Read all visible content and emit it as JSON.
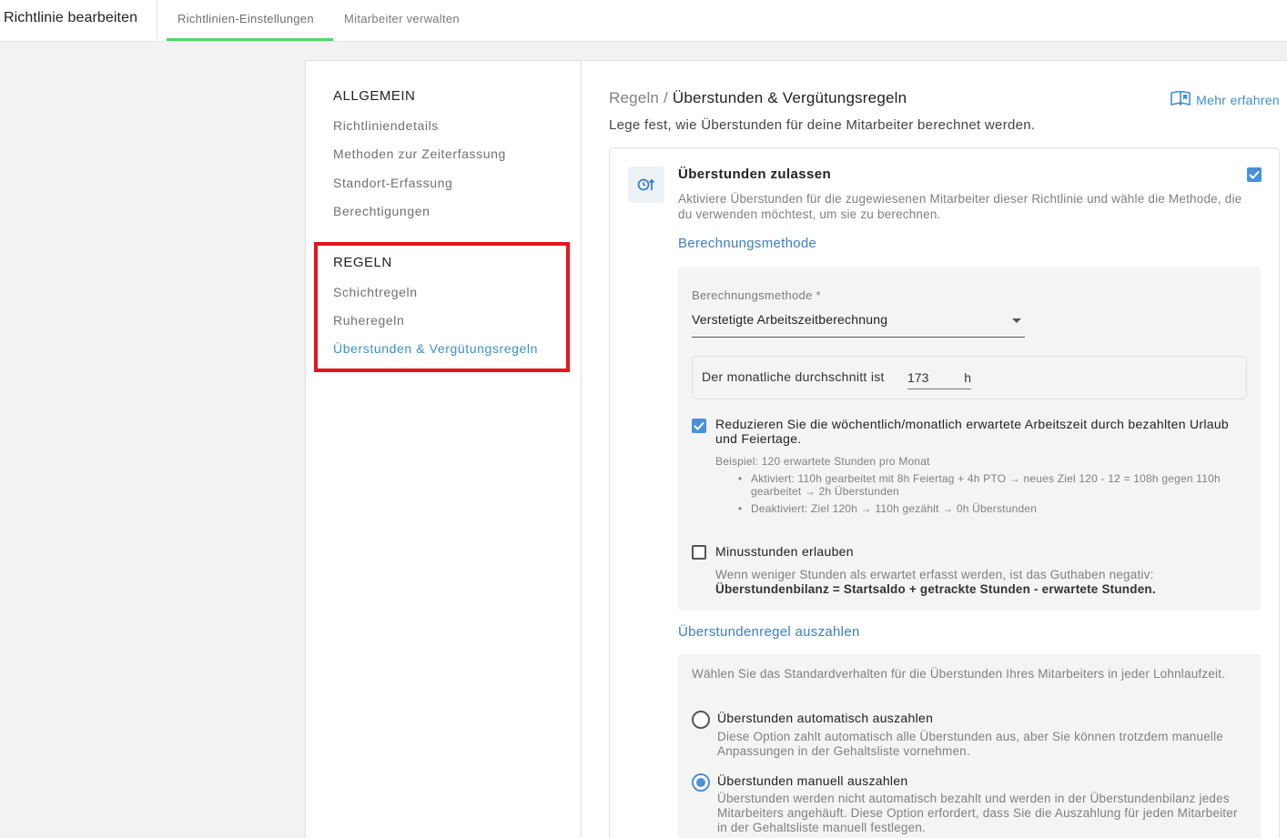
{
  "topbar": {
    "title": "Richtlinie bearbeiten",
    "tabs": [
      {
        "label": "Richtlinien-Einstellungen",
        "active": true
      },
      {
        "label": "Mitarbeiter verwalten",
        "active": false
      }
    ],
    "active_color": "#4cd964"
  },
  "sidebar": {
    "sections": [
      {
        "heading": "ALLGEMEIN",
        "items": [
          {
            "label": "Richtliniendetails"
          },
          {
            "label": "Methoden zur Zeiterfassung"
          },
          {
            "label": "Standort-Erfassung"
          },
          {
            "label": "Berechtigungen"
          }
        ]
      },
      {
        "heading": "REGELN",
        "items": [
          {
            "label": "Schichtregeln"
          },
          {
            "label": "Ruheregeln"
          },
          {
            "label": "Überstunden & Vergütungsregeln",
            "active": true
          }
        ]
      }
    ],
    "highlight_color": "#e8141b"
  },
  "main": {
    "breadcrumb_parent": "Regeln /",
    "breadcrumb_current": "Überstunden & Vergütungsregeln",
    "learn_more": "Mehr erfahren",
    "learn_more_icon": "book-icon",
    "subtitle": "Lege fest, wie Überstunden für deine Mitarbeiter berechnet werden.",
    "overtime": {
      "icon": "overtime-clock-icon",
      "title": "Überstunden zulassen",
      "enabled": true,
      "description": "Aktiviere Überstunden für die zugewiesenen Mitarbeiter dieser Richtlinie und wähle die Methode, die du verwenden möchtest, um sie zu berechnen."
    },
    "calculation": {
      "section_title": "Berechnungsmethode",
      "field_label": "Berechnungsmethode *",
      "selected_method": "Verstetigte Arbeitszeitberechnung",
      "monthly_avg_label": "Der monatliche durchschnitt ist",
      "monthly_avg_value": "173",
      "monthly_avg_unit": "h",
      "reduce_checkbox": {
        "checked": true,
        "label": "Reduzieren Sie die wöchentlich/monatlich erwartete Arbeitszeit durch bezahlten Urlaub und Feiertage.",
        "example_title": "Beispiel: 120 erwartete Stunden pro Monat",
        "examples": [
          "Aktiviert: 110h gearbeitet mit 8h Feiertag + 4h PTO → neues Ziel 120 - 12 = 108h gegen 110h gearbeitet → 2h Überstunden",
          "Deaktiviert: Ziel 120h → 110h gezählt → 0h Überstunden"
        ]
      },
      "minus_checkbox": {
        "checked": false,
        "label": "Minusstunden erlauben",
        "description": "Wenn weniger Stunden als erwartet erfasst werden, ist das Guthaben negativ:",
        "formula": "Überstundenbilanz = Startsaldo + getrackte Stunden - erwartete Stunden."
      }
    },
    "payout": {
      "section_title": "Überstundenregel auszahlen",
      "intro": "Wählen Sie das Standardverhalten für die Überstunden Ihres Mitarbeiters in jeder Lohnlaufzeit.",
      "options": [
        {
          "label": "Überstunden automatisch auszahlen",
          "description": "Diese Option zahlt automatisch alle Überstunden aus, aber Sie können trotzdem manuelle Anpassungen in der Gehaltsliste vornehmen.",
          "selected": false
        },
        {
          "label": "Überstunden manuell auszahlen",
          "description": "Überstunden werden nicht automatisch bezahlt und werden in der Überstundenbilanz jedes Mitarbeiters angehäuft. Diese Option erfordert, dass Sie die Auszahlung für jeden Mitarbeiter in der Gehaltsliste manuell festlegen.",
          "selected": true
        }
      ]
    },
    "accent_color": "#4a90d9"
  }
}
